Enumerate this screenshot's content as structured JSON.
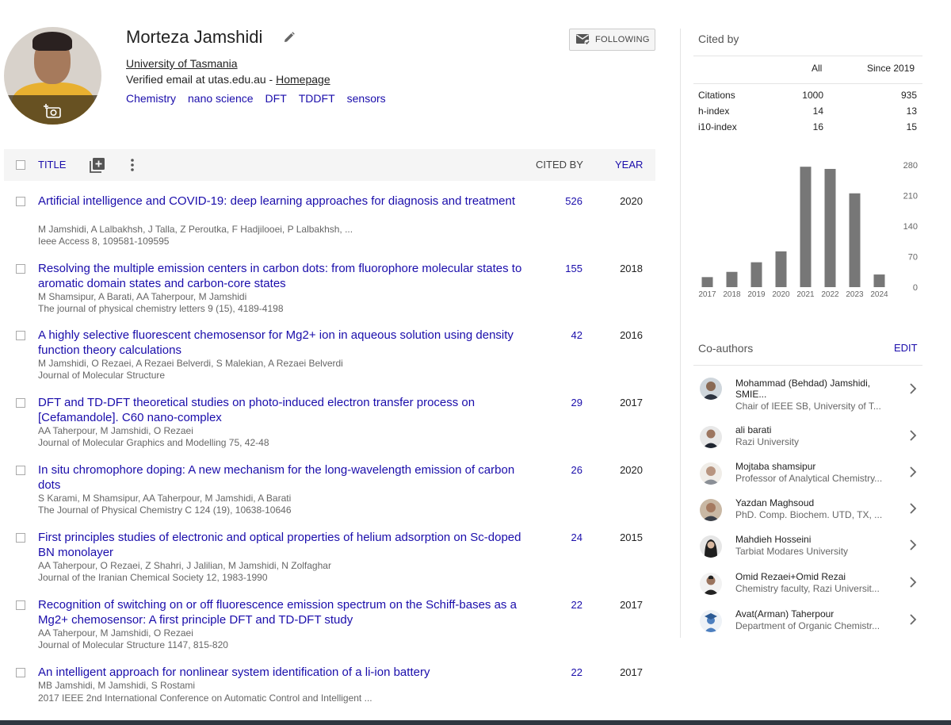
{
  "profile": {
    "name": "Morteza Jamshidi",
    "affiliation": "University of Tasmania",
    "verified_text": "Verified email at utas.edu.au - ",
    "homepage_label": "Homepage",
    "interests": [
      "Chemistry",
      "nano science",
      "DFT",
      "TDDFT",
      "sensors"
    ],
    "follow_label": "FOLLOWING"
  },
  "table": {
    "title_header": "TITLE",
    "cited_by_header": "CITED BY",
    "year_header": "YEAR"
  },
  "publications": [
    {
      "title": "Artificial intelligence and COVID-19: deep learning approaches for diagnosis and treatment",
      "authors": "M Jamshidi, A Lalbakhsh, J Talla, Z Peroutka, F Hadjilooei, P Lalbakhsh, ...",
      "venue": "Ieee Access 8, 109581-109595",
      "cited_by": "526",
      "year": "2020"
    },
    {
      "title": "Resolving the multiple emission centers in carbon dots: from fluorophore molecular states to aromatic domain states and carbon-core states",
      "authors": "M Shamsipur, A Barati, AA Taherpour, M Jamshidi",
      "venue": "The journal of physical chemistry letters 9 (15), 4189-4198",
      "cited_by": "155",
      "year": "2018"
    },
    {
      "title": "A highly selective fluorescent chemosensor for Mg2+ ion in aqueous solution using density function theory calculations",
      "authors": "M Jamshidi, O Rezaei, A Rezaei Belverdi, S Malekian, A Rezaei Belverdi",
      "venue": "Journal of Molecular Structure",
      "cited_by": "42",
      "year": "2016"
    },
    {
      "title": "DFT and TD-DFT theoretical studies on photo-induced electron transfer process on [Cefamandole]. C60 nano-complex",
      "authors": "AA Taherpour, M Jamshidi, O Rezaei",
      "venue": "Journal of Molecular Graphics and Modelling 75, 42-48",
      "cited_by": "29",
      "year": "2017"
    },
    {
      "title": "In situ chromophore doping: A new mechanism for the long-wavelength emission of carbon dots",
      "authors": "S Karami, M Shamsipur, AA Taherpour, M Jamshidi, A Barati",
      "venue": "The Journal of Physical Chemistry C 124 (19), 10638-10646",
      "cited_by": "26",
      "year": "2020"
    },
    {
      "title": "First principles studies of electronic and optical properties of helium adsorption on Sc-doped BN monolayer",
      "authors": "AA Taherpour, O Rezaei, Z Shahri, J Jalilian, M Jamshidi, N Zolfaghar",
      "venue": "Journal of the Iranian Chemical Society 12, 1983-1990",
      "cited_by": "24",
      "year": "2015"
    },
    {
      "title": "Recognition of switching on or off fluorescence emission spectrum on the Schiff-bases as a Mg2+ chemosensor: A first principle DFT and TD-DFT study",
      "authors": "AA Taherpour, M Jamshidi, O Rezaei",
      "venue": "Journal of Molecular Structure 1147, 815-820",
      "cited_by": "22",
      "year": "2017"
    },
    {
      "title": "An intelligent approach for nonlinear system identification of a li-ion battery",
      "authors": "MB Jamshidi, M Jamshidi, S Rostami",
      "venue": "2017 IEEE 2nd International Conference on Automatic Control and Intelligent ...",
      "cited_by": "22",
      "year": "2017"
    }
  ],
  "cited_by": {
    "title": "Cited by",
    "col_all": "All",
    "col_since": "Since 2019",
    "rows": [
      {
        "label": "Citations",
        "all": "1000",
        "since": "935"
      },
      {
        "label": "h-index",
        "all": "14",
        "since": "13"
      },
      {
        "label": "i10-index",
        "all": "16",
        "since": "15"
      }
    ]
  },
  "chart_data": {
    "type": "bar",
    "categories": [
      "2017",
      "2018",
      "2019",
      "2020",
      "2021",
      "2022",
      "2023",
      "2024"
    ],
    "values": [
      23,
      35,
      57,
      82,
      276,
      271,
      215,
      29
    ],
    "yticks": [
      "0",
      "70",
      "140",
      "210",
      "280"
    ],
    "ylim": [
      0,
      280
    ],
    "bar_color": "#777777",
    "grid": false
  },
  "coauthors": {
    "title": "Co-authors",
    "edit_label": "EDIT",
    "items": [
      {
        "name": "Mohammad (Behdad) Jamshidi, SMIE...",
        "affiliation": "Chair of IEEE SB, University of T..."
      },
      {
        "name": "ali barati",
        "affiliation": "Razi University"
      },
      {
        "name": "Mojtaba shamsipur",
        "affiliation": "Professor of Analytical Chemistry..."
      },
      {
        "name": "Yazdan Maghsoud",
        "affiliation": "PhD. Comp. Biochem. UTD, TX, ..."
      },
      {
        "name": "Mahdieh Hosseini",
        "affiliation": "Tarbiat Modares University"
      },
      {
        "name": "Omid Rezaei+Omid Rezai",
        "affiliation": "Chemistry faculty, Razi Universit..."
      },
      {
        "name": "Avat(Arman) Taherpour",
        "affiliation": "Department of Organic Chemistr..."
      }
    ]
  },
  "colors": {
    "link": "#1a0dab",
    "muted": "#666666",
    "bar": "#777777"
  }
}
